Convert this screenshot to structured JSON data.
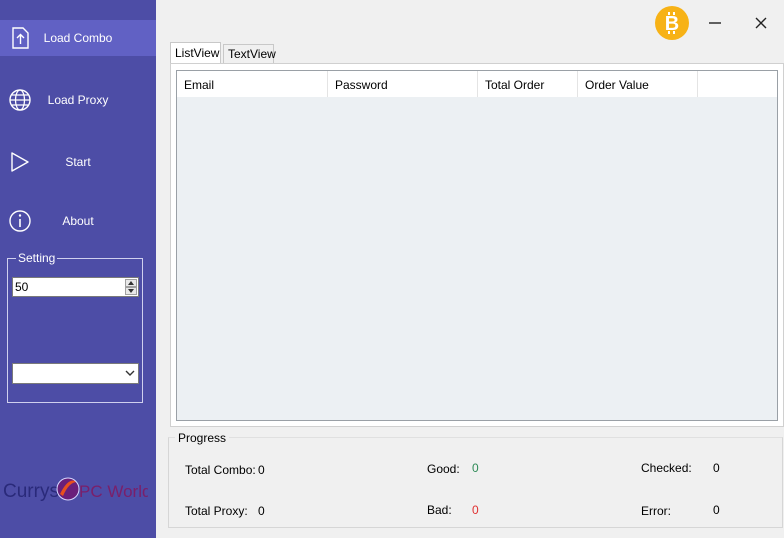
{
  "sidebar": {
    "items": [
      {
        "label": "Load Combo",
        "icon": "upload-file-icon"
      },
      {
        "label": "Load Proxy",
        "icon": "globe-icon"
      },
      {
        "label": "Start",
        "icon": "play-icon"
      },
      {
        "label": "About",
        "icon": "info-icon"
      }
    ],
    "setting": {
      "legend": "Setting",
      "threads_value": "50",
      "dropdown_value": ""
    },
    "logo": {
      "text_left": "Currys",
      "text_right": "PC World"
    }
  },
  "tabs": [
    {
      "label": "ListView",
      "active": true
    },
    {
      "label": "TextView",
      "active": false
    }
  ],
  "table": {
    "columns": [
      "Email",
      "Password",
      "Total Order",
      "Order Value"
    ],
    "rows": []
  },
  "progress": {
    "legend": "Progress",
    "total_combo_label": "Total Combo:",
    "total_combo_value": "0",
    "total_proxy_label": "Total Proxy:",
    "total_proxy_value": "0",
    "good_label": "Good:",
    "good_value": "0",
    "bad_label": "Bad:",
    "bad_value": "0",
    "checked_label": "Checked:",
    "checked_value": "0",
    "error_label": "Error:",
    "error_value": "0"
  },
  "colors": {
    "sidebar_bg": "#4d4da6",
    "sidebar_active": "#6161c4",
    "bitcoin": "#f7b216",
    "good": "#2e8b57",
    "bad": "#e03030"
  }
}
